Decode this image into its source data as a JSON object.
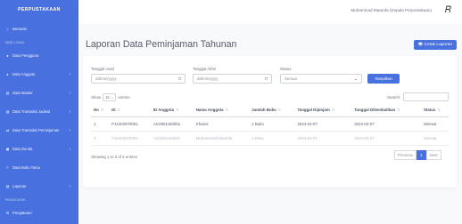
{
  "brand": "PERPUSTAKAAN",
  "sidebar": {
    "items": [
      {
        "icon": "home-icon",
        "label": "Beranda"
      },
      {
        "section": "MENU UTAMA"
      },
      {
        "icon": "user-icon",
        "label": "Data Pengguna"
      },
      {
        "icon": "users-icon",
        "label": "Data Anggota",
        "chevron": true
      },
      {
        "icon": "book-icon",
        "label": "Data Master",
        "chevron": true
      },
      {
        "icon": "database-icon",
        "label": "Data Transaksi Jadwal",
        "chevron": true
      },
      {
        "icon": "exchange-icon",
        "label": "Data Transaksi Peminjaman",
        "chevron": true
      },
      {
        "icon": "money-icon",
        "label": "Data Denda",
        "chevron": true
      },
      {
        "icon": "list-icon",
        "label": "Data Buku Tamu"
      },
      {
        "icon": "report-icon",
        "label": "Laporan",
        "chevron": true
      },
      {
        "section": "PENGATURAN"
      },
      {
        "icon": "gear-icon",
        "label": "Pengaturan"
      }
    ]
  },
  "topbar": {
    "user": "Muhammad Maarufa (Kepala Perpustakaan)"
  },
  "page": {
    "title": "Laporan Data Peminjaman Tahunan",
    "print_label": "Cetak Laporan"
  },
  "filters": {
    "start_label": "Tanggal Awal",
    "start_placeholder": "dd/mm/yyyy",
    "end_label": "Tanggal Akhir",
    "end_placeholder": "dd/mm/yyyy",
    "status_label": "Status",
    "status_value": "Semua",
    "submit_label": "Tampilkan"
  },
  "table_controls": {
    "show_label": "Show",
    "page_size": "15",
    "entries_label": "entries",
    "search_label": "Search:"
  },
  "table": {
    "columns": [
      "No",
      "ID",
      "ID Anggota",
      "Nama Anggota",
      "Jumlah Buku",
      "Tanggal Dipinjam",
      "Tanggal Dikembalikan",
      "Status"
    ],
    "rows": [
      [
        "1",
        "PJ2402070001",
        "AG2501160001",
        "Khairul",
        "1 Buku",
        "2024-02-07",
        "2024-02-07",
        "Selesai"
      ],
      [
        "2",
        "PJ2402070002",
        "AG2501160001",
        "Muhammad Maarufa",
        "1 Buku",
        "2024-02-07",
        "2024-02-07",
        "Selesai"
      ]
    ]
  },
  "footer": {
    "entries_text": "Showing 1 to 2 of 2 entries",
    "prev_label": "Previous",
    "page": "1",
    "next_label": "Next"
  },
  "colors": {
    "accent": "#4870de",
    "sidebar_bg": "#4870de"
  }
}
